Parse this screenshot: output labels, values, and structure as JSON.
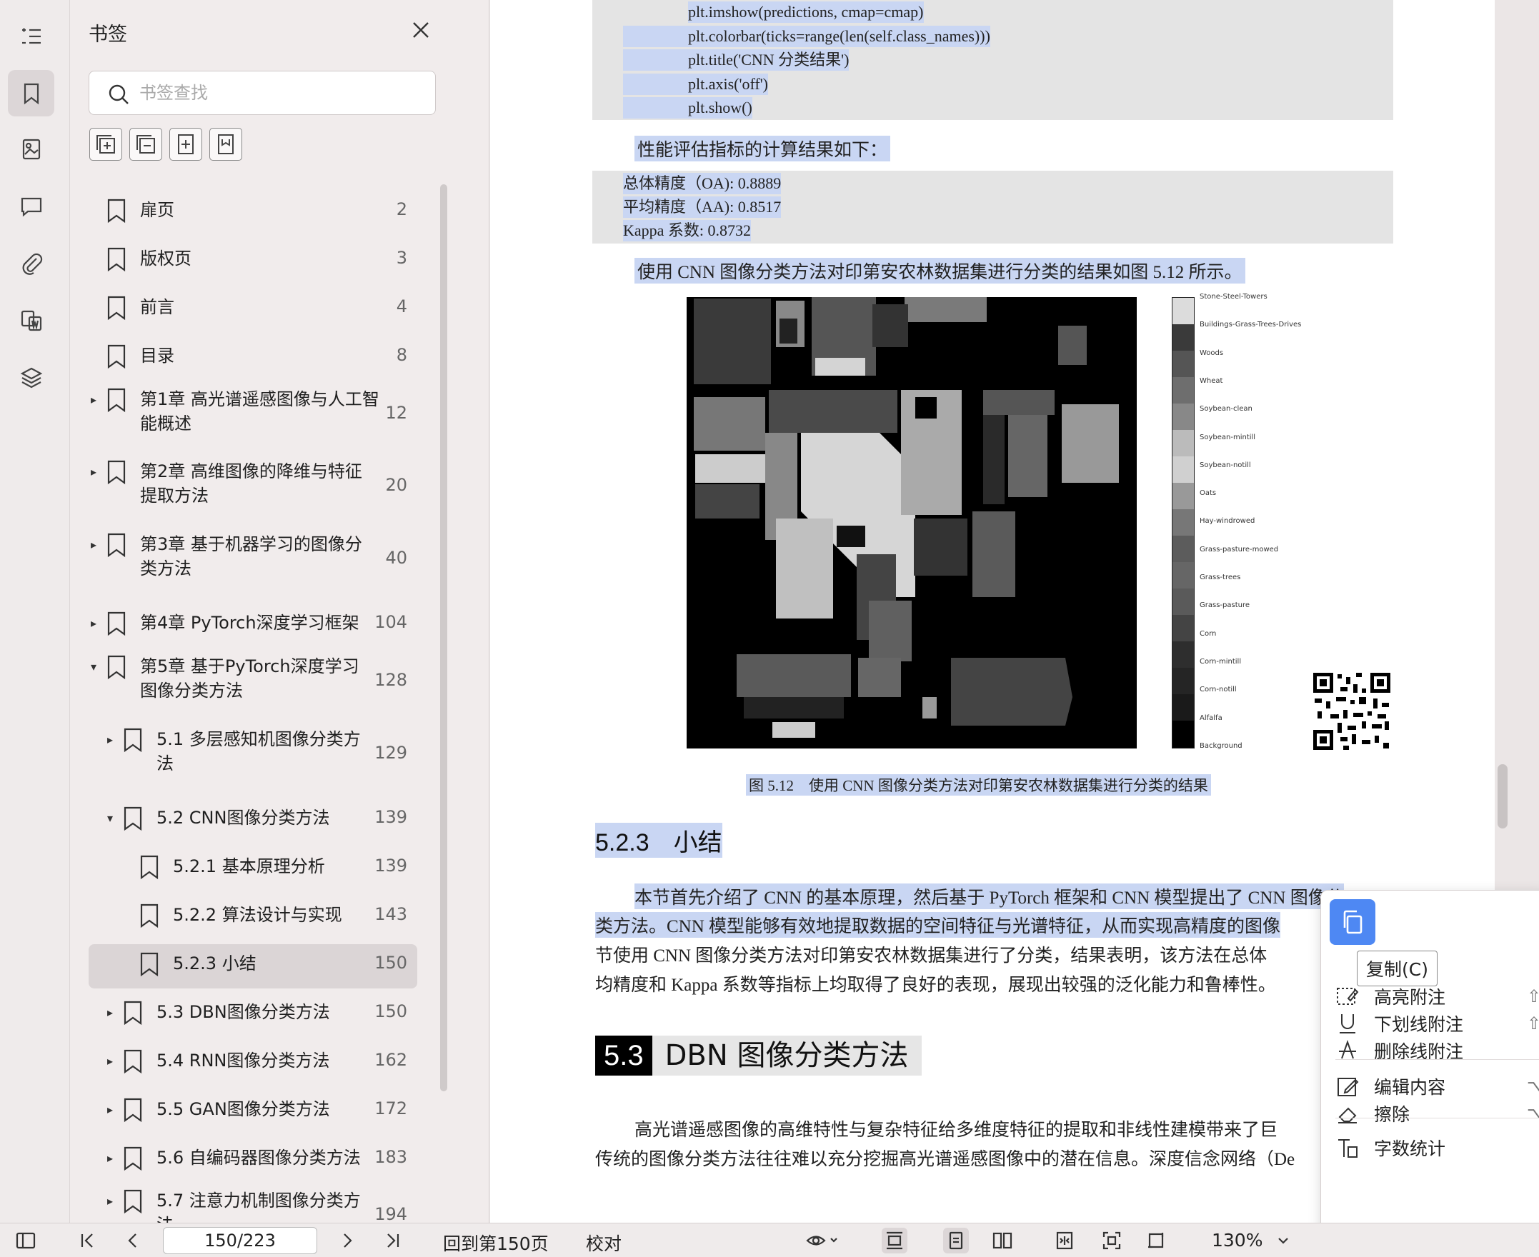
{
  "sidebar_rail": {
    "items": [
      "outline-icon",
      "bookmark-icon",
      "thumbnail-icon",
      "comment-icon",
      "attachment-icon",
      "translate-icon",
      "layers-icon"
    ]
  },
  "bookmarks": {
    "title": "书签",
    "search_placeholder": "书签查找",
    "items": [
      {
        "label": "扉页",
        "page": "2",
        "level": 0,
        "arrow": ""
      },
      {
        "label": "版权页",
        "page": "3",
        "level": 0,
        "arrow": ""
      },
      {
        "label": "前言",
        "page": "4",
        "level": 0,
        "arrow": ""
      },
      {
        "label": "目录",
        "page": "8",
        "level": 0,
        "arrow": ""
      },
      {
        "label": "第1章 高光谱遥感图像与人工智能概述",
        "line1": "第1章 高光谱遥感图像与人工智",
        "line2": "能概述",
        "page": "12",
        "level": 0,
        "arrow": "▸"
      },
      {
        "label": "第2章 高维图像的降维与特征提取方法",
        "line1": "第2章 高维图像的降维与特征",
        "line2": "提取方法",
        "page": "20",
        "level": 0,
        "arrow": "▸"
      },
      {
        "label": "第3章 基于机器学习的图像分类方法",
        "line1": "第3章 基于机器学习的图像分",
        "line2": "类方法",
        "page": "40",
        "level": 0,
        "arrow": "▸"
      },
      {
        "label": "第4章 PyTorch深度学习框架",
        "page": "104",
        "level": 0,
        "arrow": "▸"
      },
      {
        "label": "第5章 基于PyTorch深度学习图像分类方法",
        "line1": "第5章 基于PyTorch深度学习",
        "line2": "图像分类方法",
        "page": "128",
        "level": 0,
        "arrow": "▾"
      },
      {
        "label": "5.1 多层感知机图像分类方法",
        "line1": "5.1 多层感知机图像分类方",
        "line2": "法",
        "page": "129",
        "level": 1,
        "arrow": "▸"
      },
      {
        "label": "5.2 CNN图像分类方法",
        "page": "139",
        "level": 1,
        "arrow": "▾"
      },
      {
        "label": "5.2.1 基本原理分析",
        "page": "139",
        "level": 2,
        "arrow": ""
      },
      {
        "label": "5.2.2 算法设计与实现",
        "page": "143",
        "level": 2,
        "arrow": ""
      },
      {
        "label": "5.2.3 小结",
        "page": "150",
        "level": 2,
        "arrow": "",
        "active": true
      },
      {
        "label": "5.3 DBN图像分类方法",
        "page": "150",
        "level": 1,
        "arrow": "▸"
      },
      {
        "label": "5.4 RNN图像分类方法",
        "page": "162",
        "level": 1,
        "arrow": "▸"
      },
      {
        "label": "5.5 GAN图像分类方法",
        "page": "172",
        "level": 1,
        "arrow": "▸"
      },
      {
        "label": "5.6 自编码器图像分类方法",
        "page": "183",
        "level": 1,
        "arrow": "▸"
      },
      {
        "label": "5.7 注意力机制图像分类方法",
        "line1": "5.7 注意力机制图像分类方",
        "line2": "法",
        "page": "194",
        "level": 1,
        "arrow": "▸"
      }
    ]
  },
  "document": {
    "code1": [
      "plt.imshow(predictions, cmap=cmap)",
      "plt.colorbar(ticks=range(len(self.class_names)))",
      "plt.title('CNN 分类结果')",
      "plt.axis('off')",
      "plt.show()"
    ],
    "metrics_intro": "性能评估指标的计算结果如下：",
    "metrics": [
      "总体精度（OA): 0.8889",
      "平均精度（AA): 0.8517",
      "Kappa 系数: 0.8732"
    ],
    "fig_intro": "使用 CNN 图像分类方法对印第安农林数据集进行分类的结果如图 5.12 所示。",
    "colorbar_labels": [
      "Stone-Steel-Towers",
      "Buildings-Grass-Trees-Drives",
      "Woods",
      "Wheat",
      "Soybean-clean",
      "Soybean-mintill",
      "Soybean-notill",
      "Oats",
      "Hay-windrowed",
      "Grass-pasture-mowed",
      "Grass-trees",
      "Grass-pasture",
      "Corn",
      "Corn-mintill",
      "Corn-notill",
      "Alfalfa",
      "Background"
    ],
    "fig_caption": "图 5.12　使用 CNN 图像分类方法对印第安农林数据集进行分类的结果",
    "section_heading": "5.2.3　小结",
    "summary_lines": [
      "本节首先介绍了 CNN 的基本原理，然后基于 PyTorch 框架和 CNN 模型提出了 CNN 图像分",
      "类方法。CNN 模型能够有效地提取数据的空间特征与光谱特征，从而实现高精度的图像",
      "节使用 CNN 图像分类方法对印第安农林数据集进行了分类，结果表明，该方法在总体",
      "均精度和 Kappa 系数等指标上均取得了良好的表现，展现出较强的泛化能力和鲁棒性。"
    ],
    "chapter_num": "5.3",
    "chapter_title": "DBN 图像分类方法",
    "body_lines": [
      "高光谱遥感图像的高维特性与复杂特征给多维度特征的提取和非线性建模带来了巨",
      "传统的图像分类方法往往难以充分挖掘高光谱遥感图像中的潜在信息。深度信念网络（De"
    ]
  },
  "context_menu": {
    "copy_tooltip": "复制(C)",
    "items": [
      {
        "label": "高亮附注",
        "icon": "highlight-icon",
        "shortcut": "⇧⌘"
      },
      {
        "label": "下划线附注",
        "icon": "underline-icon",
        "shortcut": "⇧⌘"
      },
      {
        "label": "删除线附注",
        "icon": "strikethrough-icon",
        "shortcut": ""
      },
      {
        "label": "编辑内容",
        "icon": "edit-icon",
        "shortcut": "⌥"
      },
      {
        "label": "擦除",
        "icon": "eraser-icon",
        "shortcut": "⌥"
      },
      {
        "label": "字数统计",
        "icon": "word-count-icon",
        "shortcut": ""
      }
    ]
  },
  "toolbar": {
    "page_value": "150/223",
    "back_to_page": "回到第150页",
    "proofread": "校对",
    "zoom": "130%"
  },
  "colors": {
    "accent": "#4e88f3",
    "highlight": "#c9d6f3"
  }
}
